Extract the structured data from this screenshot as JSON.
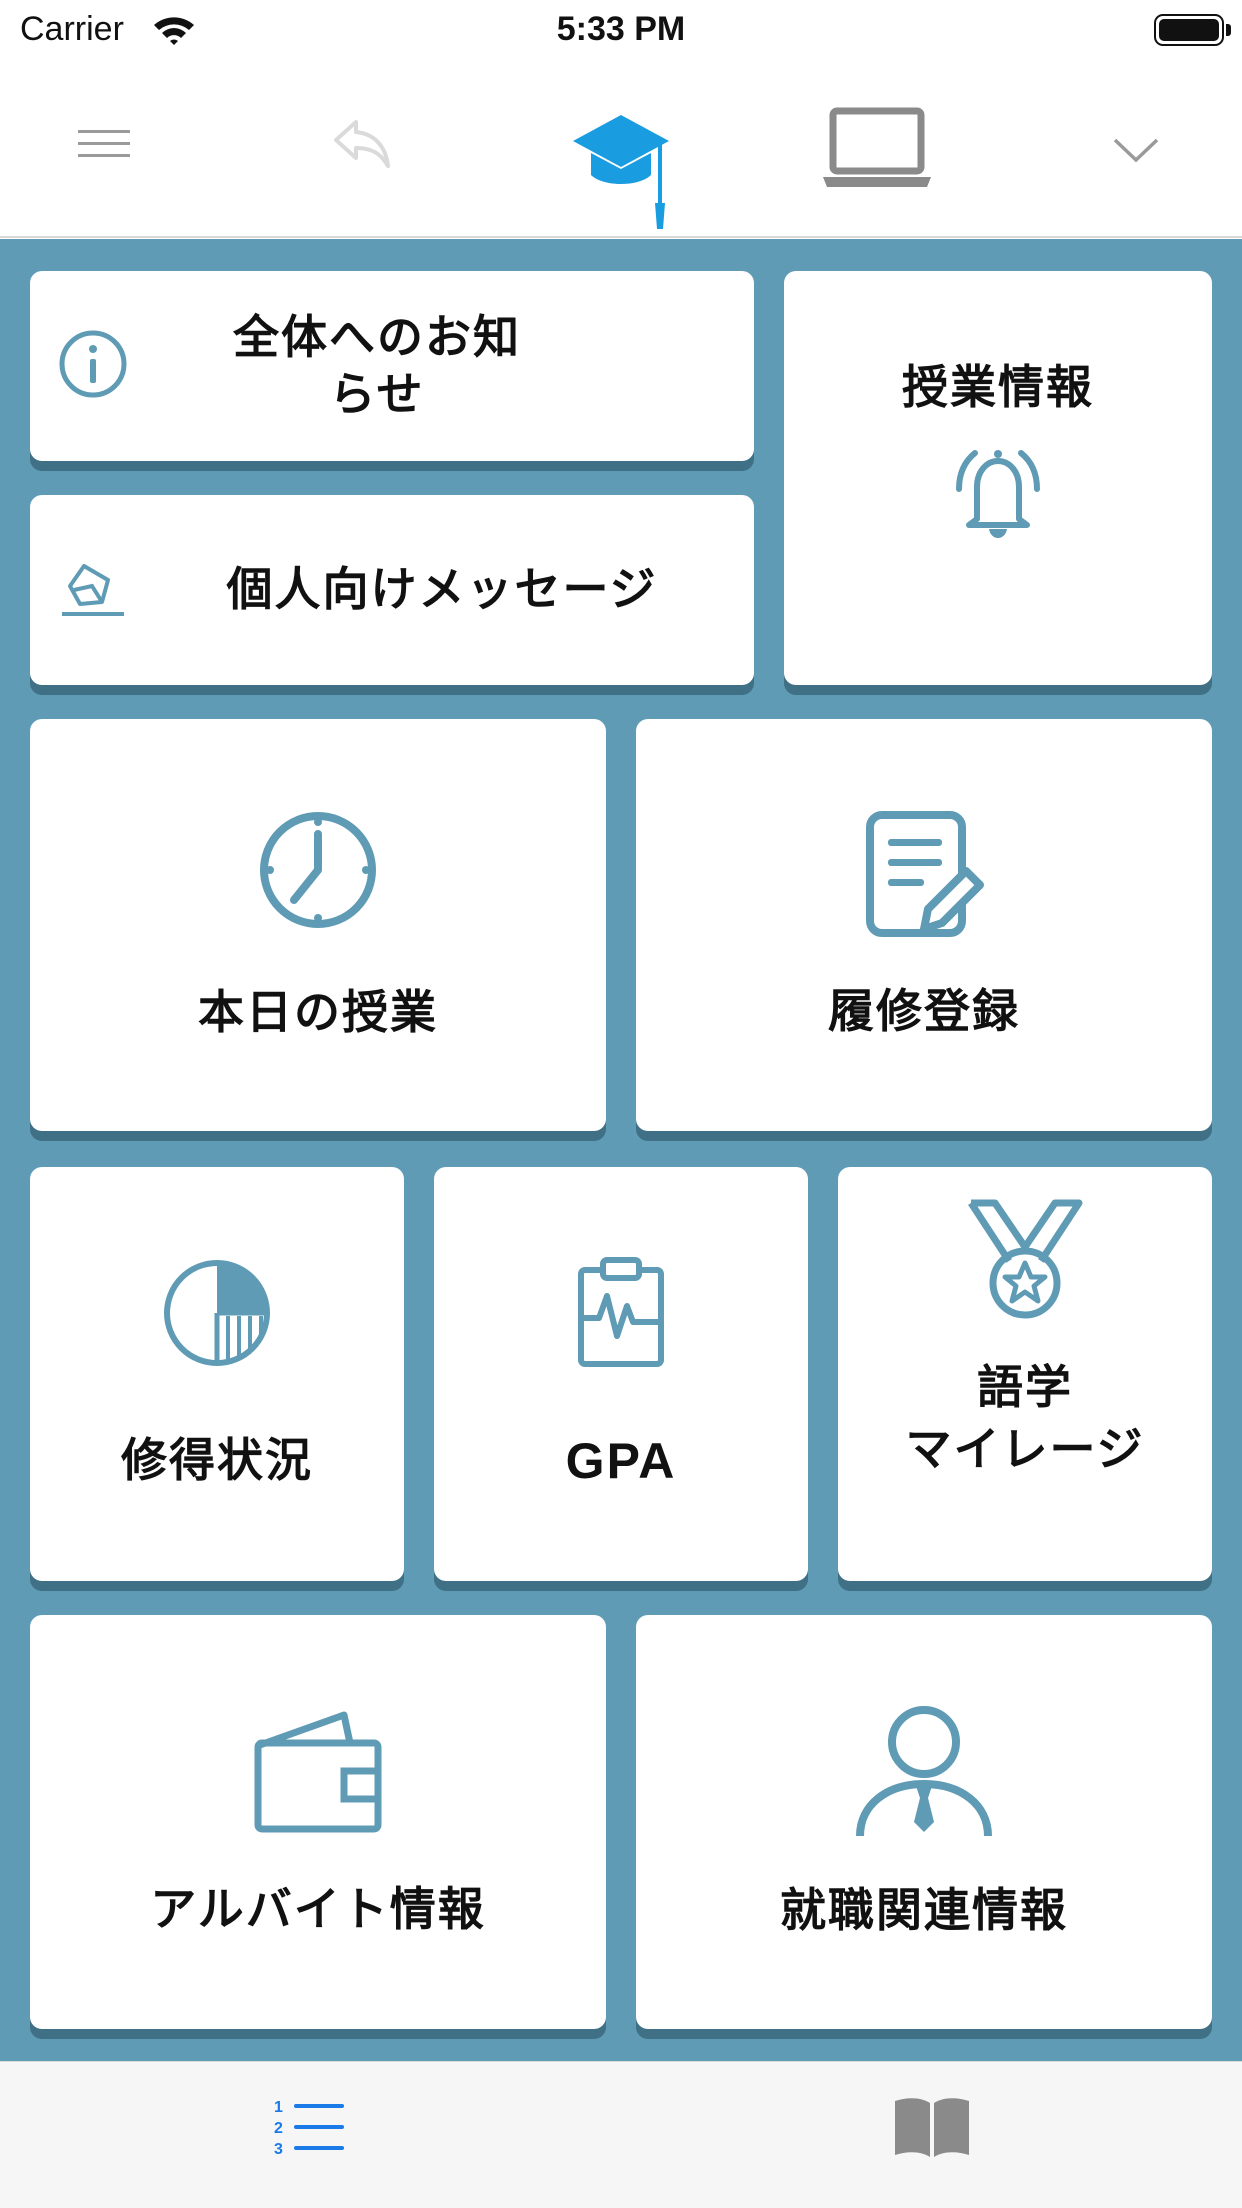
{
  "status_bar": {
    "carrier": "Carrier",
    "time": "5:33 PM"
  },
  "nav": {
    "menu_icon": "hamburger-menu-icon",
    "back_icon": "reply-back-icon",
    "center_icon": "graduation-cap-icon",
    "laptop_icon": "laptop-icon",
    "chevron_icon": "chevron-down-icon"
  },
  "tiles": {
    "announcements": {
      "label": "全体へのお知\nらせ",
      "icon": "info-icon"
    },
    "personal_messages": {
      "label": "個人向けメッセージ",
      "icon": "envelope-icon"
    },
    "class_info": {
      "label": "授業情報",
      "icon": "bell-icon"
    },
    "today_classes": {
      "label": "本日の授業",
      "icon": "clock-icon"
    },
    "registration": {
      "label": "履修登録",
      "icon": "document-edit-icon"
    },
    "credits_status": {
      "label": "修得状況",
      "icon": "pie-chart-icon"
    },
    "gpa": {
      "label": "GPA",
      "icon": "clipboard-chart-icon"
    },
    "language_mileage": {
      "label_line1": "語学",
      "label_line2": "マイレージ",
      "icon": "medal-icon"
    },
    "part_time_jobs": {
      "label": "アルバイト情報",
      "icon": "wallet-icon"
    },
    "career_info": {
      "label": "就職関連情報",
      "icon": "person-tie-icon"
    }
  },
  "tab_bar": {
    "list_icon": "numbered-list-icon",
    "book_icon": "book-icon"
  },
  "colors": {
    "accent": "#5f9bb4",
    "tile_shadow": "#3f7085",
    "cap_blue": "#1a9de0",
    "tab_active": "#1a7ae8"
  }
}
